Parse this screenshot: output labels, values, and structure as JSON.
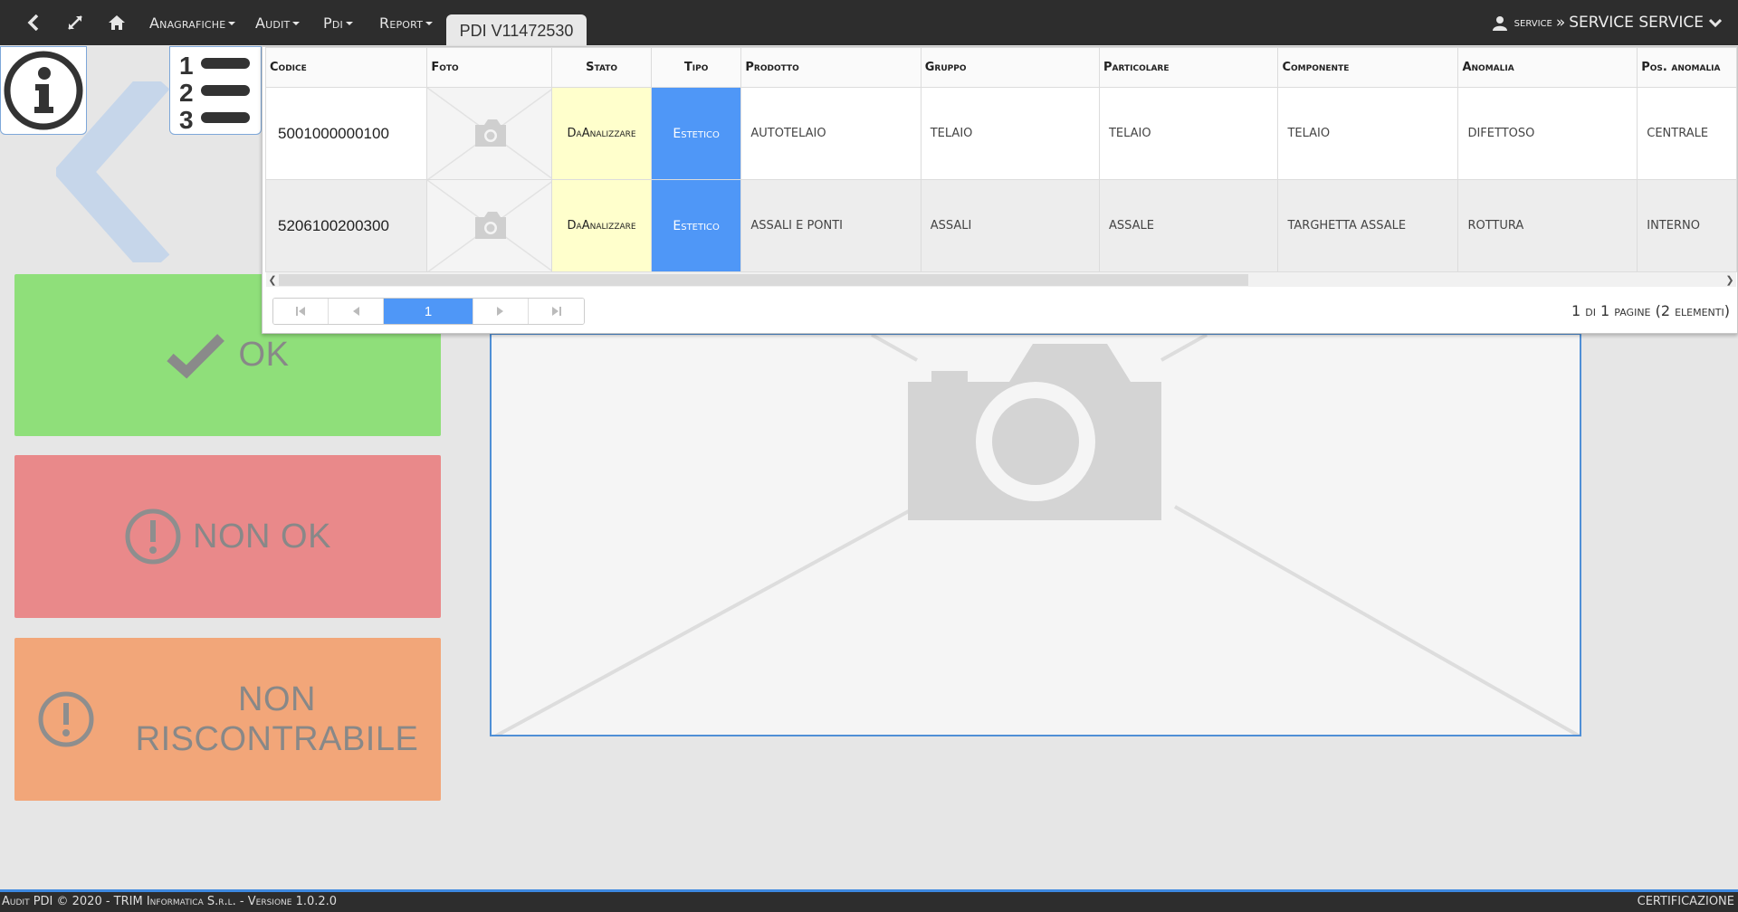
{
  "navbar": {
    "menus": [
      "Anagrafiche",
      "Audit",
      "Pdi",
      "Report"
    ],
    "active_tab": "PDI V11472530",
    "user_role": "service",
    "user_separator": "»",
    "user_name": "SERVICE SERVICE"
  },
  "status_buttons": {
    "ok": "OK",
    "non_ok": "NON OK",
    "non_riscontrabile_line1": "NON",
    "non_riscontrabile_line2": "RISCONTRABILE"
  },
  "grid": {
    "columns": [
      "Codice",
      "Foto",
      "Stato",
      "Tipo",
      "Prodotto",
      "Gruppo",
      "Particolare",
      "Componente",
      "Anomalia",
      "Pos. anomalia"
    ],
    "rows": [
      {
        "codice": "5001000000100",
        "stato": "DaAnalizzare",
        "tipo": "Estetico",
        "prodotto": "AUTOTELAIO",
        "gruppo": "TELAIO",
        "particolare": "TELAIO",
        "componente": "TELAIO",
        "anomalia": "DIFETTOSO",
        "pos_anomalia": "CENTRALE"
      },
      {
        "codice": "5206100200300",
        "stato": "DaAnalizzare",
        "tipo": "Estetico",
        "prodotto": "ASSALI E PONTI",
        "gruppo": "ASSALI",
        "particolare": "ASSALE",
        "componente": "TARGHETTA ASSALE",
        "anomalia": "ROTTURA",
        "pos_anomalia": "INTERNO"
      }
    ],
    "pager": {
      "current_page": "1",
      "info": "1 di 1 pagine (2 elementi)"
    }
  },
  "footer": {
    "left": "Audit PDI © 2020 - TRIM Informatica S.r.l. - Versione 1.0.2.0",
    "right": "CERTIFICAZIONE"
  },
  "colors": {
    "navbar": "#2d2d2d",
    "ok": "#8fdf7a",
    "non_ok": "#e9898a",
    "non_riscontrabile": "#f2a679",
    "accent": "#4f97f7",
    "stato_bg": "#ffffcc"
  },
  "icons": [
    "chevron-left-icon",
    "expand-icon",
    "home-icon",
    "user-icon",
    "chevron-down-icon",
    "info-icon",
    "numbered-list-icon",
    "back-arrow-icon",
    "checkmark-icon",
    "exclamation-circle-icon",
    "camera-icon"
  ]
}
